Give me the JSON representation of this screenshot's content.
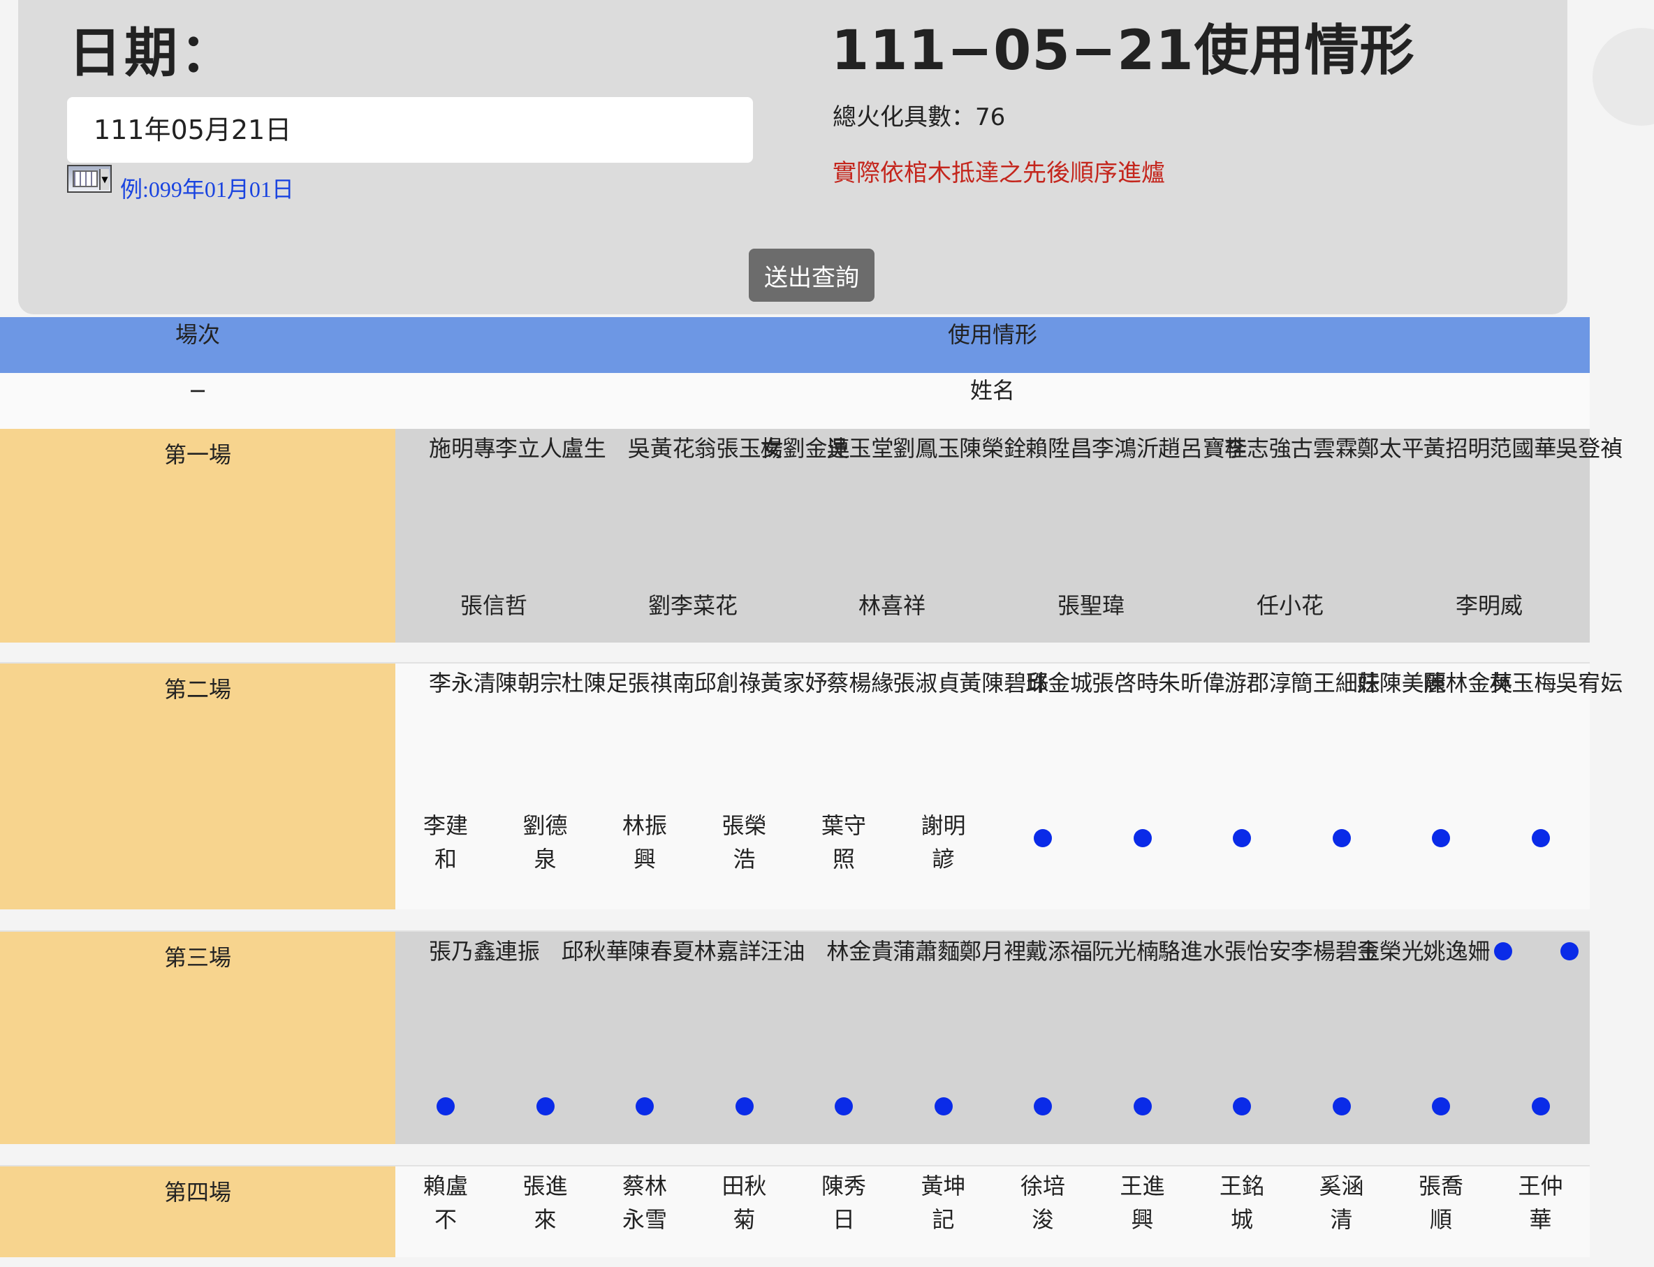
{
  "form": {
    "date_label": "日期：",
    "date_value": "111年05月21日",
    "calendar_icon": "calendar-icon",
    "example_hint": "例:099年01月01日",
    "submit_label": "送出查詢"
  },
  "summary": {
    "title": "111−05−21使用情形",
    "total": "總火化具數：76",
    "notice": "實際依棺木抵達之先後順序進爐",
    "notice_color": "#c4261d"
  },
  "table": {
    "header": {
      "col1": "場次",
      "col2": "使用情形"
    },
    "subheader": {
      "col1": "−",
      "col2": "姓名"
    },
    "header_color": "#6d97e4",
    "round_color": "#f7d48e",
    "dot_color": "#0a2be8",
    "rounds": [
      {
        "label": "第一場",
        "row1": [
          "施明專",
          "李立人",
          "盧生",
          "吳黃花",
          "翁張玉女",
          "楊劉金連",
          "吳玉堂",
          "劉鳳玉",
          "陳榮銓",
          "賴陞昌",
          "李鴻沂",
          "趙呂寶桂",
          "李志強",
          "古雲霖",
          "鄭太平",
          "黃招明",
          "范國華",
          "吳登禎"
        ],
        "row2": [
          "張信哲",
          "劉李菜花",
          "林喜祥",
          "張聖瑋",
          "任小花",
          "李明威"
        ]
      },
      {
        "label": "第二場",
        "row1": [
          "李永清",
          "陳朝宗",
          "杜陳足",
          "張祺南",
          "邱創祿",
          "黃家妤",
          "蔡楊緣",
          "張淑貞",
          "黃陳碧珠",
          "邱金城",
          "張啓時",
          "朱昕偉",
          "游郡淳",
          "簡王細妹",
          "莊陳美麗",
          "陳林金英",
          "林玉梅",
          "吳宥妘"
        ],
        "row2": [
          "李建和",
          "劉德泉",
          "林振興",
          "張榮浩",
          "葉守照",
          "謝明諺",
          "●",
          "●",
          "●",
          "●",
          "●",
          "●"
        ]
      },
      {
        "label": "第三場",
        "row1": [
          "張乃鑫",
          "連振",
          "邱秋華",
          "陳春夏",
          "林嘉詳",
          "汪油",
          "林金貴",
          "蒲蕭麵",
          "鄭月裡",
          "戴添福",
          "阮光楠",
          "駱進水",
          "張怡安",
          "李楊碧玉",
          "金榮光",
          "姚逸姍",
          "●",
          "●"
        ],
        "row2": [
          "●",
          "●",
          "●",
          "●",
          "●",
          "●",
          "●",
          "●",
          "●",
          "●",
          "●",
          "●"
        ]
      },
      {
        "label": "第四場",
        "row1": [
          "賴盧不",
          "張進來",
          "蔡林永雪",
          "田秋菊",
          "陳秀日",
          "黃坤記",
          "徐培浚",
          "王進興",
          "王銘城",
          "奚涵清",
          "張喬順",
          "王仲華"
        ]
      }
    ]
  }
}
